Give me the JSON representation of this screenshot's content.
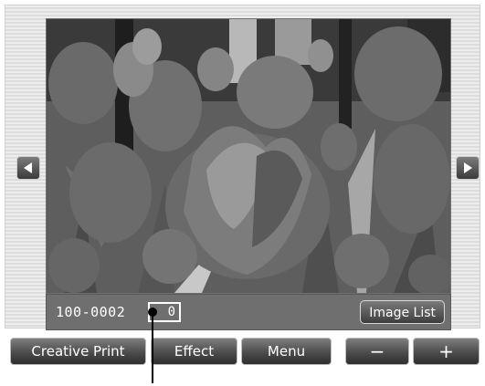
{
  "viewer": {
    "file_number": "100-0002",
    "count_value": "0",
    "image_list_label": "Image List",
    "left_arrow_icon": "triangle-left-icon",
    "right_arrow_icon": "triangle-right-icon"
  },
  "toolbar": {
    "creative_print_label": "Creative Print",
    "effect_label": "Effect",
    "menu_label": "Menu",
    "minus_label": "−",
    "plus_label": "+"
  }
}
